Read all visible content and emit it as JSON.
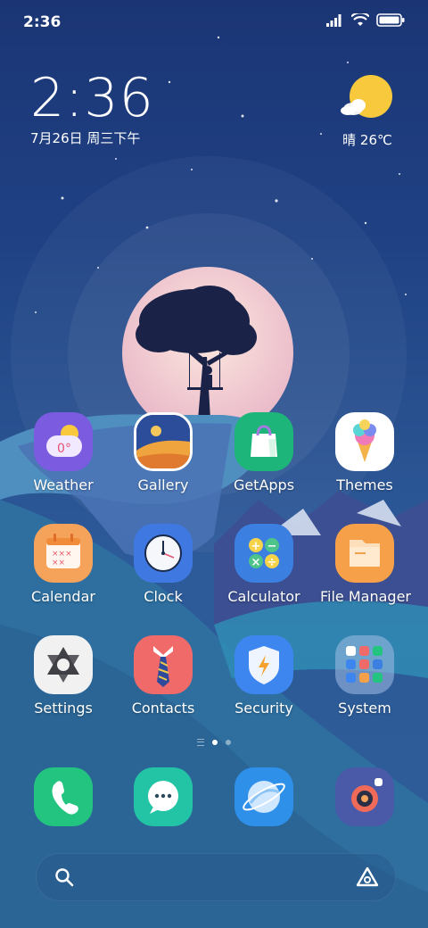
{
  "status_bar": {
    "time": "2:36",
    "icons": [
      "signal-icon",
      "wifi-icon",
      "battery-icon"
    ]
  },
  "clock_widget": {
    "time": "2:36",
    "date": "7月26日 周三下午"
  },
  "weather_widget": {
    "icon": "partly-sunny-icon",
    "text": "晴 26℃"
  },
  "apps": [
    {
      "id": "weather",
      "label": "Weather",
      "icon": "weather-icon"
    },
    {
      "id": "gallery",
      "label": "Gallery",
      "icon": "gallery-icon"
    },
    {
      "id": "getapps",
      "label": "GetApps",
      "icon": "shopping-bag-icon"
    },
    {
      "id": "themes",
      "label": "Themes",
      "icon": "ice-cream-icon"
    },
    {
      "id": "calendar",
      "label": "Calendar",
      "icon": "calendar-icon"
    },
    {
      "id": "clock",
      "label": "Clock",
      "icon": "clock-icon"
    },
    {
      "id": "calculator",
      "label": "Calculator",
      "icon": "calculator-icon"
    },
    {
      "id": "file-manager",
      "label": "File Manager",
      "icon": "folder-icon"
    },
    {
      "id": "settings",
      "label": "Settings",
      "icon": "settings-icon"
    },
    {
      "id": "contacts",
      "label": "Contacts",
      "icon": "contacts-icon"
    },
    {
      "id": "security",
      "label": "Security",
      "icon": "shield-icon"
    },
    {
      "id": "system",
      "label": "System",
      "icon": "folder-grid-icon"
    }
  ],
  "weather_tile_temp": "0°",
  "page_indicator": {
    "pages": 2,
    "current": 1
  },
  "dock": [
    {
      "id": "phone",
      "icon": "phone-icon"
    },
    {
      "id": "messages",
      "icon": "message-icon"
    },
    {
      "id": "browser",
      "icon": "browser-icon"
    },
    {
      "id": "camera",
      "icon": "camera-icon"
    }
  ],
  "search_bar": {
    "icon": "search-icon",
    "assistant_icon": "assistant-icon"
  },
  "colors": {
    "weather_tile": "#7b5ce0",
    "getapps_tile": "#1db57a",
    "calendar_tile": "#f5a25a",
    "clock_tile": "#3f78e0",
    "calculator_tile": "#3b7fe0",
    "filemanager_tile": "#f6a04a",
    "contacts_tile": "#f06a6a",
    "security_tile": "#3d86ef",
    "phone_tile": "#22c47f",
    "messages_tile": "#22c4a5",
    "browser_tile": "#2f90ea",
    "camera_tile": "#4a5aa8"
  }
}
